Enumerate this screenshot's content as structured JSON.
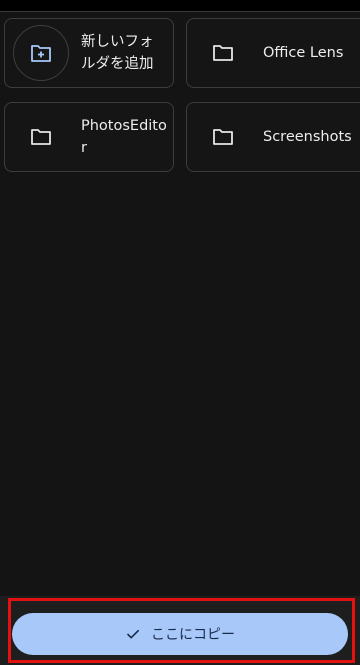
{
  "folders": [
    {
      "label": "新しいフォルダを追加",
      "icon": "new-folder-icon"
    },
    {
      "label": "Office Lens",
      "icon": "folder-icon"
    },
    {
      "label": "PhotosEditor",
      "icon": "folder-icon"
    },
    {
      "label": "Screenshots",
      "icon": "folder-icon"
    }
  ],
  "action": {
    "copy_here_label": "ここにコピー",
    "icon": "check-icon"
  },
  "colors": {
    "background": "#141414",
    "accent_button": "#a7c8f8",
    "highlight": "#e31212"
  }
}
